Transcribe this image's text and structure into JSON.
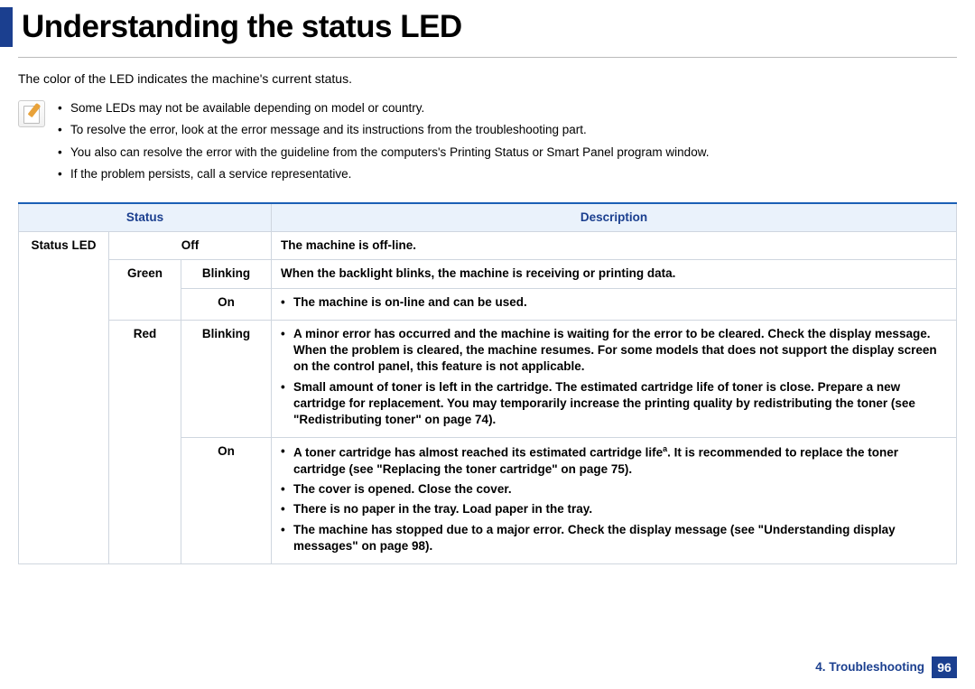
{
  "title": "Understanding the status LED",
  "intro": "The color of the LED indicates the machine's current status.",
  "notes": {
    "n0": "Some LEDs may not be available depending on model or country.",
    "n1": "To resolve the error, look at the error message and its instructions from the troubleshooting part.",
    "n2_pre": "You also can resolve the error with the guideline from the computers's ",
    "n2_em": "Printing Status or Smart Panel",
    "n2_post": " program window.",
    "n3": "If the problem persists, call a service representative."
  },
  "table": {
    "headers": {
      "status": "Status",
      "description": "Description"
    },
    "row_label": "Status LED",
    "colors": {
      "green": "Green",
      "red": "Red"
    },
    "states": {
      "off": "Off",
      "blinking": "Blinking",
      "on": "On"
    },
    "desc": {
      "off": "The machine is off-line.",
      "green_blinking": "When the backlight blinks, the machine is receiving or printing data.",
      "green_on_0": "The machine is on-line and can be used.",
      "red_blinking_0": "A minor error has occurred and the machine is waiting for the error to be cleared. Check the display message. When the problem is cleared, the machine resumes. For some models that does not support the display screen on the control panel, this feature is not applicable.",
      "red_blinking_1": "Small amount of toner is left in the cartridge. The estimated cartridge life of toner is close. Prepare a new cartridge for replacement. You may temporarily increase the printing quality by redistributing the toner (see \"Redistributing toner\" on page 74).",
      "red_on_0_pre": "A toner cartridge has almost reached its estimated cartridge life",
      "red_on_0_sup": "a",
      "red_on_0_post": ". It is recommended to replace the toner cartridge (see \"Replacing the toner cartridge\" on page 75).",
      "red_on_1": "The cover is opened. Close the cover.",
      "red_on_2": "There is no paper in the tray. Load paper in the tray.",
      "red_on_3": "The machine has stopped due to a major error. Check the display message (see \"Understanding display messages\" on page 98)."
    }
  },
  "footer": {
    "chapter": "4.  Troubleshooting",
    "page": "96"
  }
}
